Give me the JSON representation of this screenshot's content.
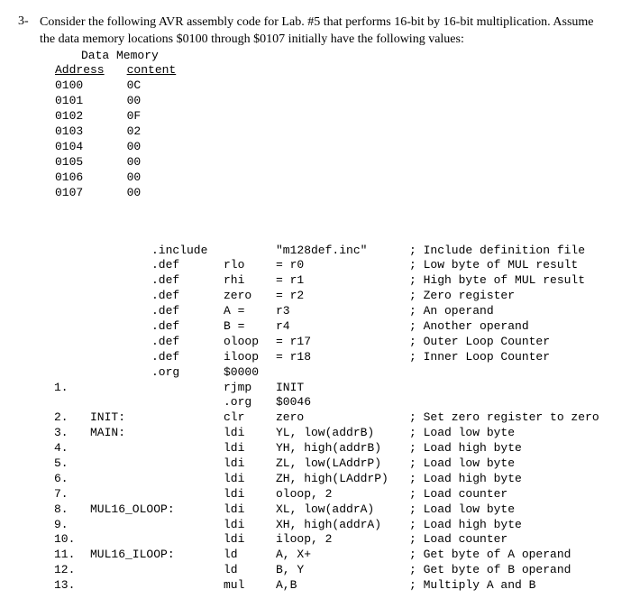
{
  "question": {
    "number": "3-",
    "text_line1": "Consider the following AVR assembly code for Lab. #5 that performs 16-bit by 16-bit multiplication.  Assume",
    "text_line2": "the data memory locations $0100 through $0107 initially have the following values:"
  },
  "mem_heading": "Data Memory",
  "mem_header_addr": "Address",
  "mem_header_content": "content",
  "memory": [
    {
      "addr": "0100",
      "val": "0C"
    },
    {
      "addr": "0101",
      "val": "00"
    },
    {
      "addr": "0102",
      "val": "0F"
    },
    {
      "addr": "0103",
      "val": "02"
    },
    {
      "addr": "0104",
      "val": "00"
    },
    {
      "addr": "0105",
      "val": "00"
    },
    {
      "addr": "0106",
      "val": "00"
    },
    {
      "addr": "0107",
      "val": "00"
    }
  ],
  "code": [
    {
      "g": "",
      "a": "",
      "b": ".include",
      "c": "",
      "d": "\"m128def.inc\"",
      "e": "; Include definition file"
    },
    {
      "g": "",
      "a": "",
      "b": ".def",
      "c": "rlo",
      "d": "= r0",
      "e": "; Low byte of MUL result"
    },
    {
      "g": "",
      "a": "",
      "b": ".def",
      "c": "rhi",
      "d": "= r1",
      "e": "; High byte of MUL result"
    },
    {
      "g": "",
      "a": "",
      "b": ".def",
      "c": "zero",
      "d": "= r2",
      "e": "; Zero register"
    },
    {
      "g": "",
      "a": "",
      "b": ".def",
      "c": "A =",
      "d": "r3",
      "e": "; An operand"
    },
    {
      "g": "",
      "a": "",
      "b": ".def",
      "c": "B =",
      "d": "r4",
      "e": "; Another operand"
    },
    {
      "g": "",
      "a": "",
      "b": ".def",
      "c": "oloop",
      "d": "= r17",
      "e": "; Outer Loop Counter"
    },
    {
      "g": "",
      "a": "",
      "b": ".def",
      "c": "iloop",
      "d": "= r18",
      "e": "; Inner Loop Counter"
    },
    {
      "g": "",
      "a": "",
      "b": ".org",
      "c": "$0000",
      "d": "",
      "e": ""
    },
    {
      "g": "1.",
      "a": "",
      "b": "",
      "c": "rjmp",
      "d": "INIT",
      "e": ""
    },
    {
      "g": "",
      "a": "",
      "b": "",
      "c": ".org",
      "d": "$0046",
      "e": ""
    },
    {
      "g": "2.",
      "a": "INIT:",
      "b": "",
      "c": "clr",
      "d": "zero",
      "e": "; Set zero register to zero"
    },
    {
      "g": "3.",
      "a": "MAIN:",
      "b": "",
      "c": "ldi",
      "d": "YL, low(addrB)",
      "e": "; Load low byte"
    },
    {
      "g": "4.",
      "a": "",
      "b": "",
      "c": "ldi",
      "d": "YH, high(addrB)",
      "e": "; Load high byte"
    },
    {
      "g": "5.",
      "a": "",
      "b": "",
      "c": "ldi",
      "d": "ZL, low(LAddrP)",
      "e": "; Load low byte"
    },
    {
      "g": "6.",
      "a": "",
      "b": "",
      "c": "ldi",
      "d": "ZH, high(LAddrP)",
      "e": "; Load high byte"
    },
    {
      "g": "7.",
      "a": "",
      "b": "",
      "c": "ldi",
      "d": "oloop, 2",
      "e": "; Load counter"
    },
    {
      "g": "8.",
      "a": "MUL16_OLOOP:",
      "b": "",
      "c": "ldi",
      "d": "XL, low(addrA)",
      "e": "; Load low byte"
    },
    {
      "g": "9.",
      "a": "",
      "b": "",
      "c": "ldi",
      "d": "XH, high(addrA)",
      "e": "; Load high byte"
    },
    {
      "g": "10.",
      "a": "",
      "b": "",
      "c": "ldi",
      "d": "iloop, 2",
      "e": "; Load counter"
    },
    {
      "g": "11.",
      "a": "MUL16_ILOOP:",
      "b": "",
      "c": "ld",
      "d": "A, X+",
      "e": "; Get byte of A operand"
    },
    {
      "g": "12.",
      "a": "",
      "b": "",
      "c": "ld",
      "d": "B, Y",
      "e": "; Get byte of B operand"
    },
    {
      "g": "13.",
      "a": "",
      "b": "",
      "c": "mul",
      "d": "A,B",
      "e": "; Multiply A and B"
    }
  ]
}
